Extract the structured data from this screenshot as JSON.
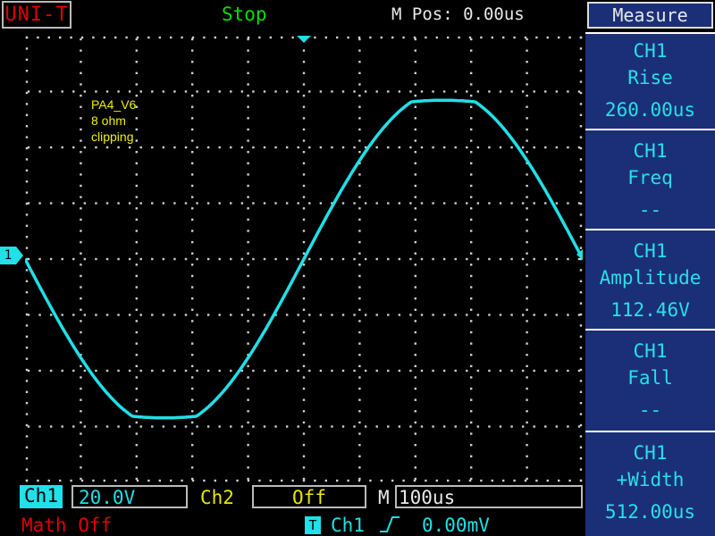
{
  "header": {
    "brand": "UNI-T",
    "run_state": "Stop",
    "m_pos": "M Pos: 0.00us"
  },
  "screen": {
    "annotation": [
      "PA4_V6",
      "8 ohm",
      "clipping"
    ],
    "ch1_marker": "1"
  },
  "measure": {
    "title": "Measure",
    "items": [
      {
        "source": "CH1",
        "name": "Rise",
        "value": "260.00us"
      },
      {
        "source": "CH1",
        "name": "Freq",
        "value": "--"
      },
      {
        "source": "CH1",
        "name": "Amplitude",
        "value": "112.46V"
      },
      {
        "source": "CH1",
        "name": "Fall",
        "value": "--"
      },
      {
        "source": "CH1",
        "name": "+Width",
        "value": "512.00us"
      }
    ]
  },
  "bottom": {
    "ch1_label": "Ch1",
    "ch1_scale": "20.0V",
    "ch2_label": "Ch2",
    "ch2_scale": "Off",
    "m_label": "M",
    "timebase": "100us",
    "math": "Math Off",
    "trig_icon": "T",
    "trig_source": "Ch1",
    "trig_slope": "rising-edge-icon",
    "trig_level": "0.00mV"
  },
  "colors": {
    "trace": "#20e0e8",
    "grid": "#cfcfcf",
    "panel": "#1b2f78",
    "brand": "#e00000",
    "ch2": "#e8e800",
    "status": "#00e000"
  }
}
